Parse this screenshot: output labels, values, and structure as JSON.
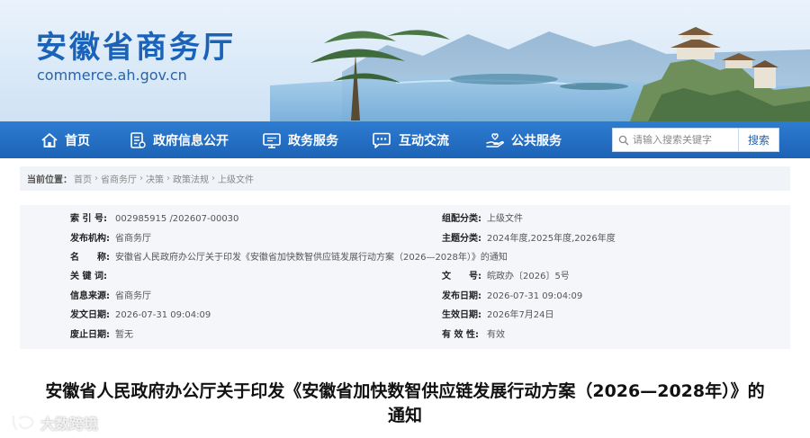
{
  "site": {
    "title": "安徽省商务厅",
    "domain": "commerce.ah.gov.cn"
  },
  "nav": {
    "items": [
      {
        "label": "首页",
        "icon": "home-icon"
      },
      {
        "label": "政府信息公开",
        "icon": "document-list-icon"
      },
      {
        "label": "政务服务",
        "icon": "monitor-icon"
      },
      {
        "label": "互动交流",
        "icon": "chat-bubble-icon"
      },
      {
        "label": "公共服务",
        "icon": "hand-heart-icon"
      }
    ],
    "search": {
      "placeholder": "请输入搜索关键字",
      "button_label": "搜索"
    }
  },
  "breadcrumb": {
    "lead": "当前位置：",
    "items": [
      "首页",
      "省商务厅",
      "决策",
      "政策法规",
      "上级文件"
    ],
    "separator": "›"
  },
  "info": {
    "index_no_label": "索 引 号:",
    "index_no": "002985915 /202607-00030",
    "category_label": "组配分类:",
    "category": "上级文件",
    "publisher_label": "发布机构:",
    "publisher": "省商务厅",
    "topic_label": "主题分类:",
    "topic": "2024年度,2025年度,2026年度",
    "name_label": "名　　称:",
    "name": "安徽省人民政府办公厅关于印发《安徽省加快数智供应链发展行动方案（2026—2028年）》的通知",
    "keywords_label": "关 键 词:",
    "keywords": "",
    "doc_no_label": "文　　号:",
    "doc_no": "皖政办〔2026〕5号",
    "source_label": "信息来源:",
    "source": "省商务厅",
    "publish_date_label": "发布日期:",
    "publish_date": "2026-07-31 09:04:09",
    "issue_date_label": "发文日期:",
    "issue_date": "2026-07-31 09:04:09",
    "effective_date_label": "生效日期:",
    "effective_date": "2026年7月24日",
    "expiry_date_label": "废止日期:",
    "expiry_date": "暂无",
    "validity_label": "有 效 性:",
    "validity": "有效"
  },
  "document": {
    "title_line1": "安徽省人民政府办公厅关于印发《安徽省加快数智供应链发展行动方案（2026—2028年）》的",
    "title_line2": "通知"
  },
  "watermark": {
    "text": "大数跨境"
  },
  "colors": {
    "brand_blue": "#1b63b8",
    "nav_blue": "#1c63b6",
    "info_bg": "#f4f6fa"
  }
}
